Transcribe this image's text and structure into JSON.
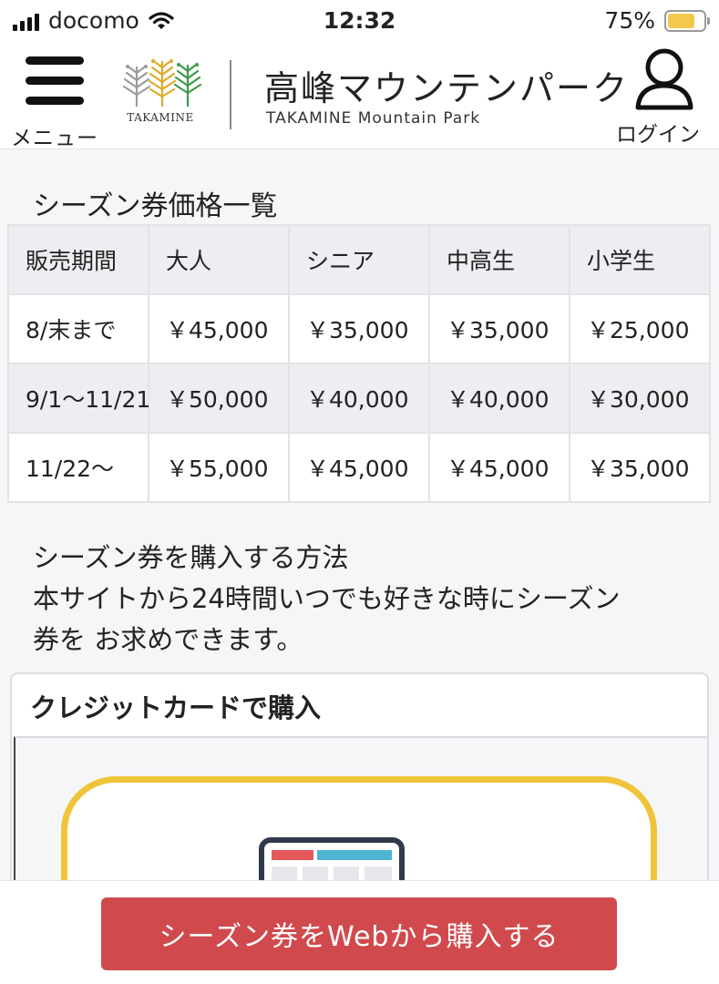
{
  "status_bar": {
    "carrier": "docomo",
    "time": "12:32",
    "battery_percent": "75%",
    "battery_level": 0.75,
    "battery_color": "#f2c94c"
  },
  "header": {
    "menu_label": "メニュー",
    "logo_text": "TAKAMINE",
    "park_title": "高峰マウンテンパーク",
    "park_subtitle": "TAKAMINE Mountain Park",
    "login_label": "ログイン",
    "icons": {
      "menu": "hamburger-icon",
      "logo": "tree-logo",
      "login": "user-icon"
    }
  },
  "price_section": {
    "title": "シーズン券価格一覧",
    "columns": [
      "販売期間",
      "大人",
      "シニア",
      "中高生",
      "小学生"
    ],
    "rows": [
      [
        "8/末まで",
        "￥45,000",
        "￥35,000",
        "￥35,000",
        "￥25,000"
      ],
      [
        "9/1〜11/21",
        "￥50,000",
        "￥40,000",
        "￥40,000",
        "￥30,000"
      ],
      [
        "11/22〜",
        "￥55,000",
        "￥45,000",
        "￥45,000",
        "￥35,000"
      ]
    ]
  },
  "howto": {
    "title": "シーズン券を購入する方法",
    "line1": "本サイトから24時間いつでも好きな時にシーズン",
    "line2": "券を お求めできます。"
  },
  "card": {
    "title": "クレジットカードで購入",
    "frame_color": "#f0c43a",
    "icon": "browser-window-icon"
  },
  "cta": {
    "label": "シーズン券をWebから購入する",
    "color": "#d04a4d"
  }
}
